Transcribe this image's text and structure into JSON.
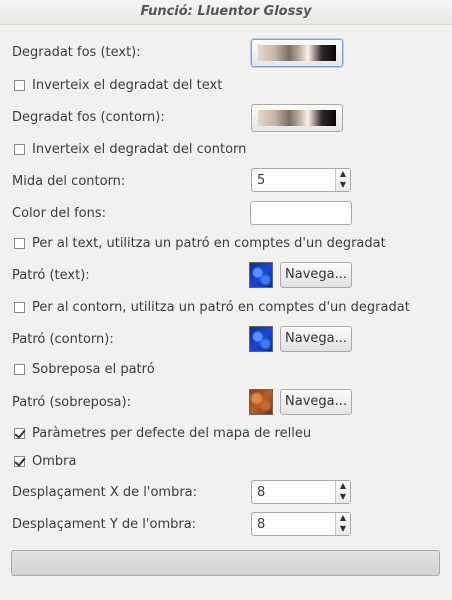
{
  "window": {
    "title": "Funció: Lluentor Glossy"
  },
  "fields": {
    "gradient_text_label": "Degradat fos (text):",
    "invert_gradient_text_label": "Inverteix el degradat del text",
    "gradient_outline_label": "Degradat fos (contorn):",
    "invert_gradient_outline_label": "Inverteix el degradat del contorn",
    "outline_size_label": "Mida del contorn:",
    "outline_size_value": "5",
    "bg_color_label": "Color del fons:",
    "bg_color_value": "#ffffff",
    "use_pattern_text_label": "Per al text, utilitza un patró en comptes d'un degradat",
    "pattern_text_label": "Patró (text):",
    "pattern_text_button": "Navega...",
    "use_pattern_outline_label": "Per al contorn, utilitza un patró en comptes d'un degradat",
    "pattern_outline_label": "Patró (contorn):",
    "pattern_outline_button": "Navega...",
    "overlay_pattern_label": "Sobreposa el patró",
    "pattern_overlay_label": "Patró (sobreposa):",
    "pattern_overlay_button": "Navega...",
    "default_bumpmap_label": "Paràmetres per defecte del mapa de relleu",
    "shadow_label": "Ombra",
    "shadow_x_label": "Desplaçament X de l'ombra:",
    "shadow_x_value": "8",
    "shadow_y_label": "Desplaçament Y de l'ombra:",
    "shadow_y_value": "8"
  },
  "checkboxes": {
    "invert_gradient_text": false,
    "invert_gradient_outline": false,
    "use_pattern_text": false,
    "use_pattern_outline": false,
    "overlay_pattern": false,
    "default_bumpmap": true,
    "shadow": true
  },
  "icons": {
    "spin_up": "chevron-up-icon",
    "spin_down": "chevron-down-icon"
  }
}
